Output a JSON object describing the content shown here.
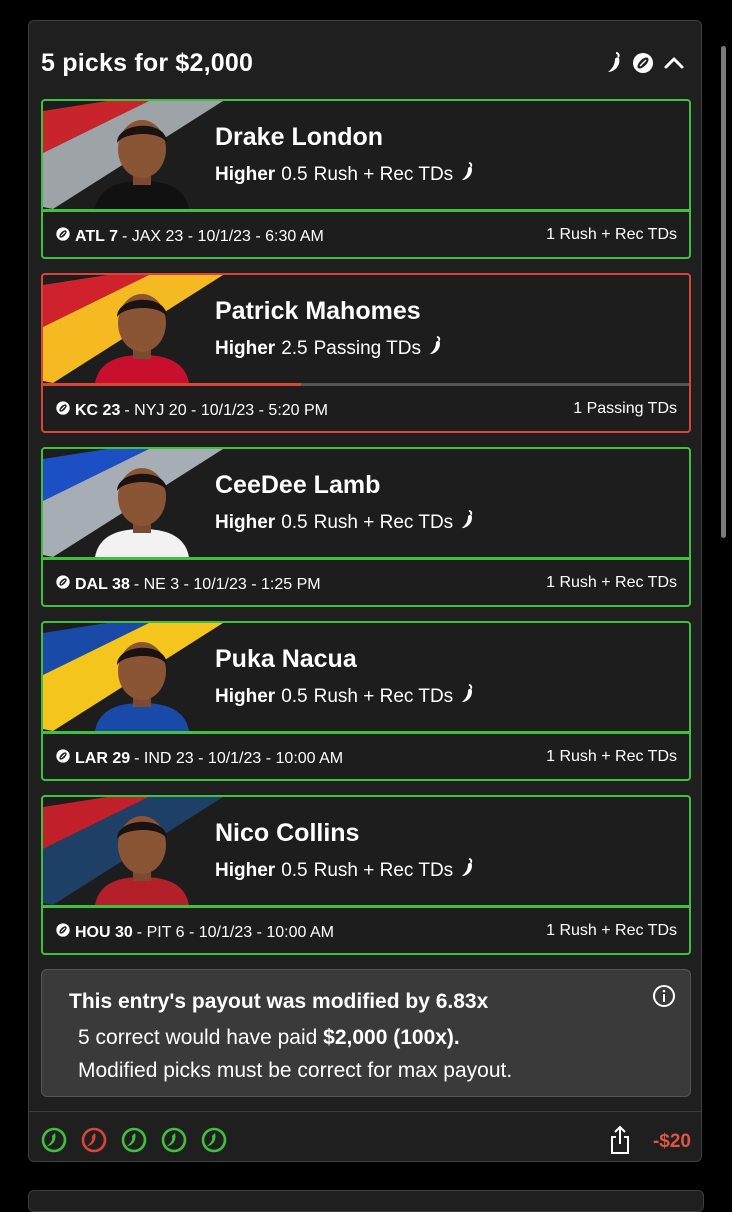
{
  "header": {
    "title": "5 picks for $2,000"
  },
  "picks": [
    {
      "name": "Drake London",
      "direction": "Higher",
      "line": "0.5",
      "stat": "Rush + Rec TDs",
      "team": "ATL 7",
      "game_rest": "- JAX 23 - 10/1/23 - 6:30 AM",
      "result": "1 Rush + Rec TDs",
      "status": "won",
      "progress": 1.0,
      "stripe_colors": [
        "#c8242c",
        "#9da3a6"
      ],
      "shirt_color": "#111111"
    },
    {
      "name": "Patrick Mahomes",
      "direction": "Higher",
      "line": "2.5",
      "stat": "Passing TDs",
      "team": "KC 23",
      "game_rest": "- NYJ 20 - 10/1/23 - 5:20 PM",
      "result": "1 Passing TDs",
      "status": "lost",
      "progress": 0.4,
      "stripe_colors": [
        "#d0222d",
        "#f5b921"
      ],
      "shirt_color": "#c8102e"
    },
    {
      "name": "CeeDee Lamb",
      "direction": "Higher",
      "line": "0.5",
      "stat": "Rush + Rec TDs",
      "team": "DAL 38",
      "game_rest": "- NE 3 - 10/1/23 - 1:25 PM",
      "result": "1 Rush + Rec TDs",
      "status": "won",
      "progress": 1.0,
      "stripe_colors": [
        "#1d4fc4",
        "#a6adb4"
      ],
      "shirt_color": "#f2f2f2"
    },
    {
      "name": "Puka Nacua",
      "direction": "Higher",
      "line": "0.5",
      "stat": "Rush + Rec TDs",
      "team": "LAR 29",
      "game_rest": "- IND 23 - 10/1/23 - 10:00 AM",
      "result": "1 Rush + Rec TDs",
      "status": "won",
      "progress": 1.0,
      "stripe_colors": [
        "#1a4aa8",
        "#f4c51c"
      ],
      "shirt_color": "#1a4aa8"
    },
    {
      "name": "Nico Collins",
      "direction": "Higher",
      "line": "0.5",
      "stat": "Rush + Rec TDs",
      "team": "HOU 30",
      "game_rest": "- PIT 6 - 10/1/23 - 10:00 AM",
      "result": "1 Rush + Rec TDs",
      "status": "won",
      "progress": 1.0,
      "stripe_colors": [
        "#c1202b",
        "#1e3f66"
      ],
      "shirt_color": "#b3202a"
    }
  ],
  "payout": {
    "title": "This entry's payout was modified by 6.83x",
    "line1_pre": "5 correct would have paid",
    "line1_bold": "$2,000 (100x).",
    "line2": "Modified picks must be correct for max payout."
  },
  "footer": {
    "results": [
      "won",
      "lost",
      "won",
      "won",
      "won"
    ],
    "amount": "-$20"
  },
  "colors": {
    "green": "#3fc13f",
    "red": "#d9453b"
  },
  "icons": {
    "hot": "chili-icon",
    "sport": "football-icon",
    "collapse": "chevron-up-icon",
    "info": "info-icon",
    "share": "share-icon"
  }
}
